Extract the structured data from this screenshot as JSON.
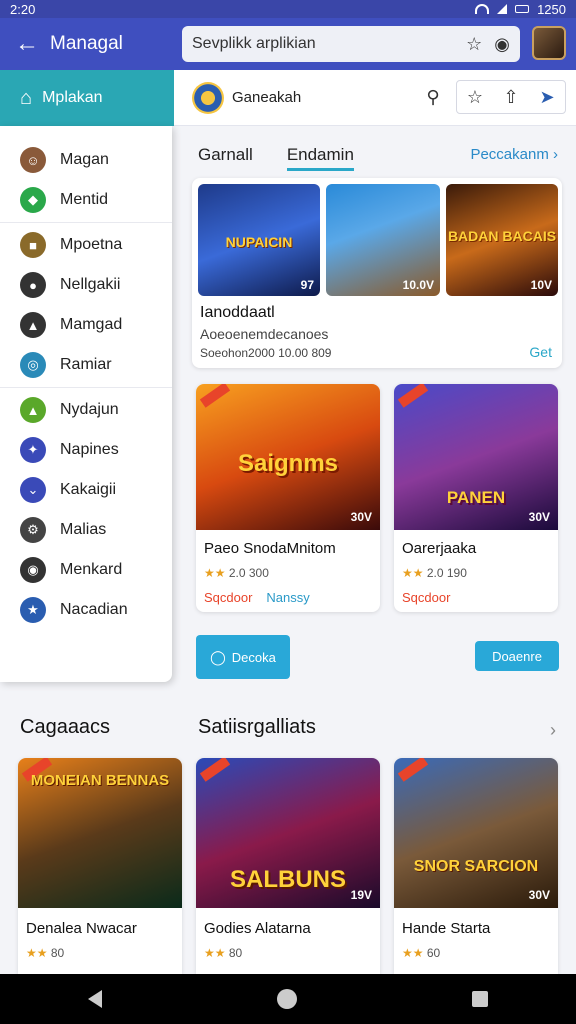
{
  "status_bar": {
    "time": "2:20",
    "right_time": "1250"
  },
  "app_bar": {
    "title": "Managal",
    "search_value": "Sevplikk arplikian"
  },
  "sub_header": {
    "title": "Ganeakah"
  },
  "drawer": {
    "header": "Mplakan",
    "items": [
      {
        "label": "Magan",
        "icon": "avatar-icon",
        "color": "#8a5a3a"
      },
      {
        "label": "Mentid",
        "icon": "tag-icon",
        "color": "#2aa84a"
      },
      {
        "label": "Mpoetna",
        "icon": "game-icon",
        "color": "#8a6a2a"
      },
      {
        "label": "Nellgakii",
        "icon": "circle-icon",
        "color": "#333333"
      },
      {
        "label": "Mamgad",
        "icon": "shapes-icon",
        "color": "#333333"
      },
      {
        "label": "Ramiar",
        "icon": "target-icon",
        "color": "#2a8ab8"
      },
      {
        "label": "Nydajun",
        "icon": "landscape-icon",
        "color": "#5aa82a"
      },
      {
        "label": "Napines",
        "icon": "compass-icon",
        "color": "#3a4ab8"
      },
      {
        "label": "Kakaigii",
        "icon": "down-icon",
        "color": "#3a4ab8"
      },
      {
        "label": "Malias",
        "icon": "gear-icon",
        "color": "#444444"
      },
      {
        "label": "Menkard",
        "icon": "dot-icon",
        "color": "#333333"
      },
      {
        "label": "Nacadian",
        "icon": "badge-icon",
        "color": "#2a5db0"
      }
    ]
  },
  "tabs": {
    "items": [
      "Garnall",
      "Endamin"
    ],
    "link": "Peccakanm ›"
  },
  "featured": {
    "thumbs": [
      {
        "art": "NUPAICIN",
        "badge": "97"
      },
      {
        "art": "",
        "badge": "10.0V"
      },
      {
        "art": "BADAN BACAIS",
        "badge": "10V"
      }
    ],
    "name": "Ianoddaatl",
    "desc": "Aoeoenemdecanoes",
    "meta": "Soeohon2000     10.00 809",
    "get": "Get"
  },
  "cards_mid": [
    {
      "art": "Saignms",
      "badge": "30V",
      "title": "Paeo SnodaMnitom",
      "rating": "2.0 300",
      "tag1": "Sqcdoor",
      "tag2": "Nanssy"
    },
    {
      "art": "PANEN",
      "badge": "30V",
      "title": "Oarerjaaka",
      "rating": "2.0 190",
      "tag1": "Sqcdoor",
      "tag2": ""
    }
  ],
  "buttons": {
    "left": "Decoka",
    "right": "Doaenre"
  },
  "sections": {
    "left_title": "Cagaaacs",
    "right_title": "Satiisrgalliats"
  },
  "cards_bottom": [
    {
      "art": "MONEIAN BENNAS",
      "badge": "",
      "title": "Denalea Nwacar",
      "rating": "80"
    },
    {
      "art": "SALBUNS",
      "badge": "19V",
      "title": "Godies Alatarna",
      "rating": "80"
    },
    {
      "art": "SNOR SARCION",
      "badge": "30V",
      "title": "Hande Starta",
      "rating": "60"
    }
  ]
}
